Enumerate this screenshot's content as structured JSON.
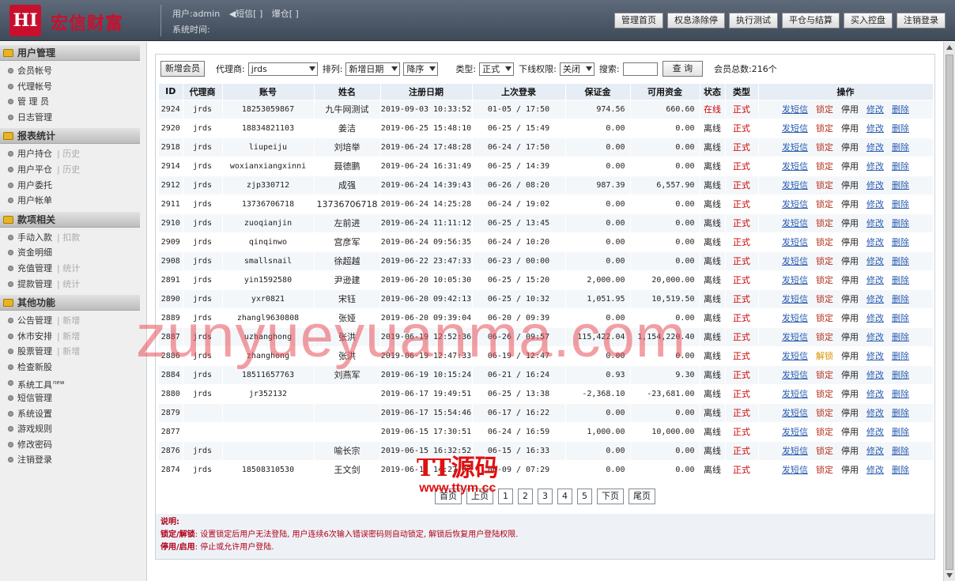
{
  "header": {
    "logo": "HI",
    "brand": "宏信财富",
    "user_label": "用户:admin",
    "sms_label": "短信[ ]",
    "position_label": "爆仓[ ]",
    "time_label": "系统时间:",
    "nav": [
      "管理首页",
      "权息涤除停",
      "执行测试",
      "平仓与结算",
      "买入控盘",
      "注销登录"
    ]
  },
  "sidebar": {
    "sections": [
      {
        "title": "用户管理",
        "items": [
          {
            "label": "会员帐号"
          },
          {
            "label": "代理帐号"
          },
          {
            "label": "管 理 员"
          },
          {
            "label": "日志管理"
          }
        ]
      },
      {
        "title": "报表统计",
        "items": [
          {
            "label": "用户持仓",
            "sub": "历史"
          },
          {
            "label": "用户平仓",
            "sub": "历史"
          },
          {
            "label": "用户委托"
          },
          {
            "label": "用户帐单"
          }
        ]
      },
      {
        "title": "款项相关",
        "items": [
          {
            "label": "手动入款",
            "sub": "扣款"
          },
          {
            "label": "资金明细"
          },
          {
            "label": "充值管理",
            "sub": "统计"
          },
          {
            "label": "提款管理",
            "sub": "统计"
          }
        ]
      },
      {
        "title": "其他功能",
        "items": [
          {
            "label": "公告管理",
            "sub": "新增"
          },
          {
            "label": "休市安排",
            "sub": "新增"
          },
          {
            "label": "股票管理",
            "sub": "新增"
          },
          {
            "label": "检查新股"
          },
          {
            "label": "系统工具",
            "sup": "new"
          },
          {
            "label": "短信管理"
          },
          {
            "label": "系统设置"
          },
          {
            "label": "游戏规则"
          },
          {
            "label": "修改密码"
          },
          {
            "label": "注销登录"
          }
        ]
      }
    ]
  },
  "toolbar": {
    "add_btn": "新增会员",
    "agent_label": "代理商:",
    "agent_value": "jrds",
    "sort_label": "排列:",
    "sort_value": "新增日期",
    "order_value": "降序",
    "type_label": "类型:",
    "type_value": "正式",
    "perm_label": "下线权限:",
    "perm_value": "关闭",
    "search_label": "搜索:",
    "query_btn": "查 询",
    "total": "会员总数:216个"
  },
  "table": {
    "headers": [
      "ID",
      "代理商",
      "账号",
      "姓名",
      "注册日期",
      "上次登录",
      "保证金",
      "可用资金",
      "状态",
      "类型",
      "操作"
    ],
    "actions": {
      "sms": "发短信",
      "lock": "锁定",
      "unlock": "解锁",
      "stop": "停用",
      "edit": "修改",
      "del": "删除"
    },
    "rows": [
      {
        "id": "2924",
        "agent": "jrds",
        "account": "18253059867",
        "name": "九牛网测试",
        "reg": "2019-09-03 10:33:52",
        "last": "01-05 / 17:50",
        "margin": "974.56",
        "avail": "660.60",
        "status": "在线",
        "type": "正式",
        "lock": "锁定"
      },
      {
        "id": "2920",
        "agent": "jrds",
        "account": "18834821103",
        "name": "姜洁",
        "reg": "2019-06-25 15:48:10",
        "last": "06-25 / 15:49",
        "margin": "0.00",
        "avail": "0.00",
        "status": "离线",
        "type": "正式",
        "lock": "锁定"
      },
      {
        "id": "2918",
        "agent": "jrds",
        "account": "liupeiju",
        "name": "刘培举",
        "reg": "2019-06-24 17:48:28",
        "last": "06-24 / 17:50",
        "margin": "0.00",
        "avail": "0.00",
        "status": "离线",
        "type": "正式",
        "lock": "锁定"
      },
      {
        "id": "2914",
        "agent": "jrds",
        "account": "woxianxiangxinni",
        "name": "聂德鹏",
        "reg": "2019-06-24 16:31:49",
        "last": "06-25 / 14:39",
        "margin": "0.00",
        "avail": "0.00",
        "status": "离线",
        "type": "正式",
        "lock": "锁定"
      },
      {
        "id": "2912",
        "agent": "jrds",
        "account": "zjp330712",
        "name": "成强",
        "reg": "2019-06-24 14:39:43",
        "last": "06-26 / 08:20",
        "margin": "987.39",
        "avail": "6,557.90",
        "status": "离线",
        "type": "正式",
        "lock": "锁定"
      },
      {
        "id": "2911",
        "agent": "jrds",
        "account": "13736706718",
        "name": "13736706718",
        "reg": "2019-06-24 14:25:28",
        "last": "06-24 / 19:02",
        "margin": "0.00",
        "avail": "0.00",
        "status": "离线",
        "type": "正式",
        "lock": "锁定"
      },
      {
        "id": "2910",
        "agent": "jrds",
        "account": "zuoqianjin",
        "name": "左前进",
        "reg": "2019-06-24 11:11:12",
        "last": "06-25 / 13:45",
        "margin": "0.00",
        "avail": "0.00",
        "status": "离线",
        "type": "正式",
        "lock": "锁定"
      },
      {
        "id": "2909",
        "agent": "jrds",
        "account": "qinqinwo",
        "name": "宫彦军",
        "reg": "2019-06-24 09:56:35",
        "last": "06-24 / 10:20",
        "margin": "0.00",
        "avail": "0.00",
        "status": "离线",
        "type": "正式",
        "lock": "锁定"
      },
      {
        "id": "2908",
        "agent": "jrds",
        "account": "smallsnail",
        "name": "徐超越",
        "reg": "2019-06-22 23:47:33",
        "last": "06-23 / 00:00",
        "margin": "0.00",
        "avail": "0.00",
        "status": "离线",
        "type": "正式",
        "lock": "锁定"
      },
      {
        "id": "2891",
        "agent": "jrds",
        "account": "yin1592580",
        "name": "尹逊建",
        "reg": "2019-06-20 10:05:30",
        "last": "06-25 / 15:20",
        "margin": "2,000.00",
        "avail": "20,000.00",
        "status": "离线",
        "type": "正式",
        "lock": "锁定"
      },
      {
        "id": "2890",
        "agent": "jrds",
        "account": "yxr0821",
        "name": "宋钰",
        "reg": "2019-06-20 09:42:13",
        "last": "06-25 / 10:32",
        "margin": "1,051.95",
        "avail": "10,519.50",
        "status": "离线",
        "type": "正式",
        "lock": "锁定"
      },
      {
        "id": "2889",
        "agent": "jrds",
        "account": "zhangl9630808",
        "name": "张娅",
        "reg": "2019-06-20 09:39:04",
        "last": "06-20 / 09:39",
        "margin": "0.00",
        "avail": "0.00",
        "status": "离线",
        "type": "正式",
        "lock": "锁定"
      },
      {
        "id": "2887",
        "agent": "jrds",
        "account": "uzhanghong",
        "name": "张洪",
        "reg": "2019-06-19 12:52:36",
        "last": "06-26 / 09:57",
        "margin": "115,422.04",
        "avail": "1,154,220.40",
        "status": "离线",
        "type": "正式",
        "lock": "锁定"
      },
      {
        "id": "2886",
        "agent": "jrds",
        "account": "zhanghong",
        "name": "张洪",
        "reg": "2019-06-19 12:47:33",
        "last": "06-19 / 12:47",
        "margin": "0.00",
        "avail": "0.00",
        "status": "离线",
        "type": "正式",
        "lock": "解锁"
      },
      {
        "id": "2884",
        "agent": "jrds",
        "account": "18511657763",
        "name": "刘燕军",
        "reg": "2019-06-19 10:15:24",
        "last": "06-21 / 16:24",
        "margin": "0.93",
        "avail": "9.30",
        "status": "离线",
        "type": "正式",
        "lock": "锁定"
      },
      {
        "id": "2880",
        "agent": "jrds",
        "account": "jr352132",
        "name": "",
        "reg": "2019-06-17 19:49:51",
        "last": "06-25 / 13:38",
        "margin": "-2,368.10",
        "avail": "-23,681.00",
        "status": "离线",
        "type": "正式",
        "lock": "锁定"
      },
      {
        "id": "2879",
        "agent": "",
        "account": "",
        "name": "",
        "reg": "2019-06-17 15:54:46",
        "last": "06-17 / 16:22",
        "margin": "0.00",
        "avail": "0.00",
        "status": "离线",
        "type": "正式",
        "lock": "锁定"
      },
      {
        "id": "2877",
        "agent": "",
        "account": "",
        "name": "",
        "reg": "2019-06-15 17:30:51",
        "last": "06-24 / 16:59",
        "margin": "1,000.00",
        "avail": "10,000.00",
        "status": "离线",
        "type": "正式",
        "lock": "锁定"
      },
      {
        "id": "2876",
        "agent": "jrds",
        "account": "",
        "name": "喻长宗",
        "reg": "2019-06-15 16:32:52",
        "last": "06-15 / 16:33",
        "margin": "0.00",
        "avail": "0.00",
        "status": "离线",
        "type": "正式",
        "lock": "锁定"
      },
      {
        "id": "2874",
        "agent": "jrds",
        "account": "18508310530",
        "name": "王文剑",
        "reg": "2019-06-15 14:27:02",
        "last": "06-09 / 07:29",
        "margin": "0.00",
        "avail": "0.00",
        "status": "离线",
        "type": "正式",
        "lock": "锁定"
      }
    ]
  },
  "pager": {
    "first": "首页",
    "prev": "上页",
    "pages": [
      "1",
      "2",
      "3",
      "4",
      "5"
    ],
    "next": "下页",
    "last": "尾页"
  },
  "notes": {
    "title": "说明:",
    "lock_label": "锁定/解锁",
    "lock_text": ": 设置锁定后用户无法登陆, 用户连续6次输入错误密码则自动锁定, 解锁后恢复用户登陆权限.",
    "stop_label": "停用/启用",
    "stop_text": ": 停止或允许用户登陆."
  },
  "watermark": {
    "text": "zunyueyuanma.com",
    "logo_text": "TT源码",
    "logo_url": "www.ttym.cc"
  }
}
